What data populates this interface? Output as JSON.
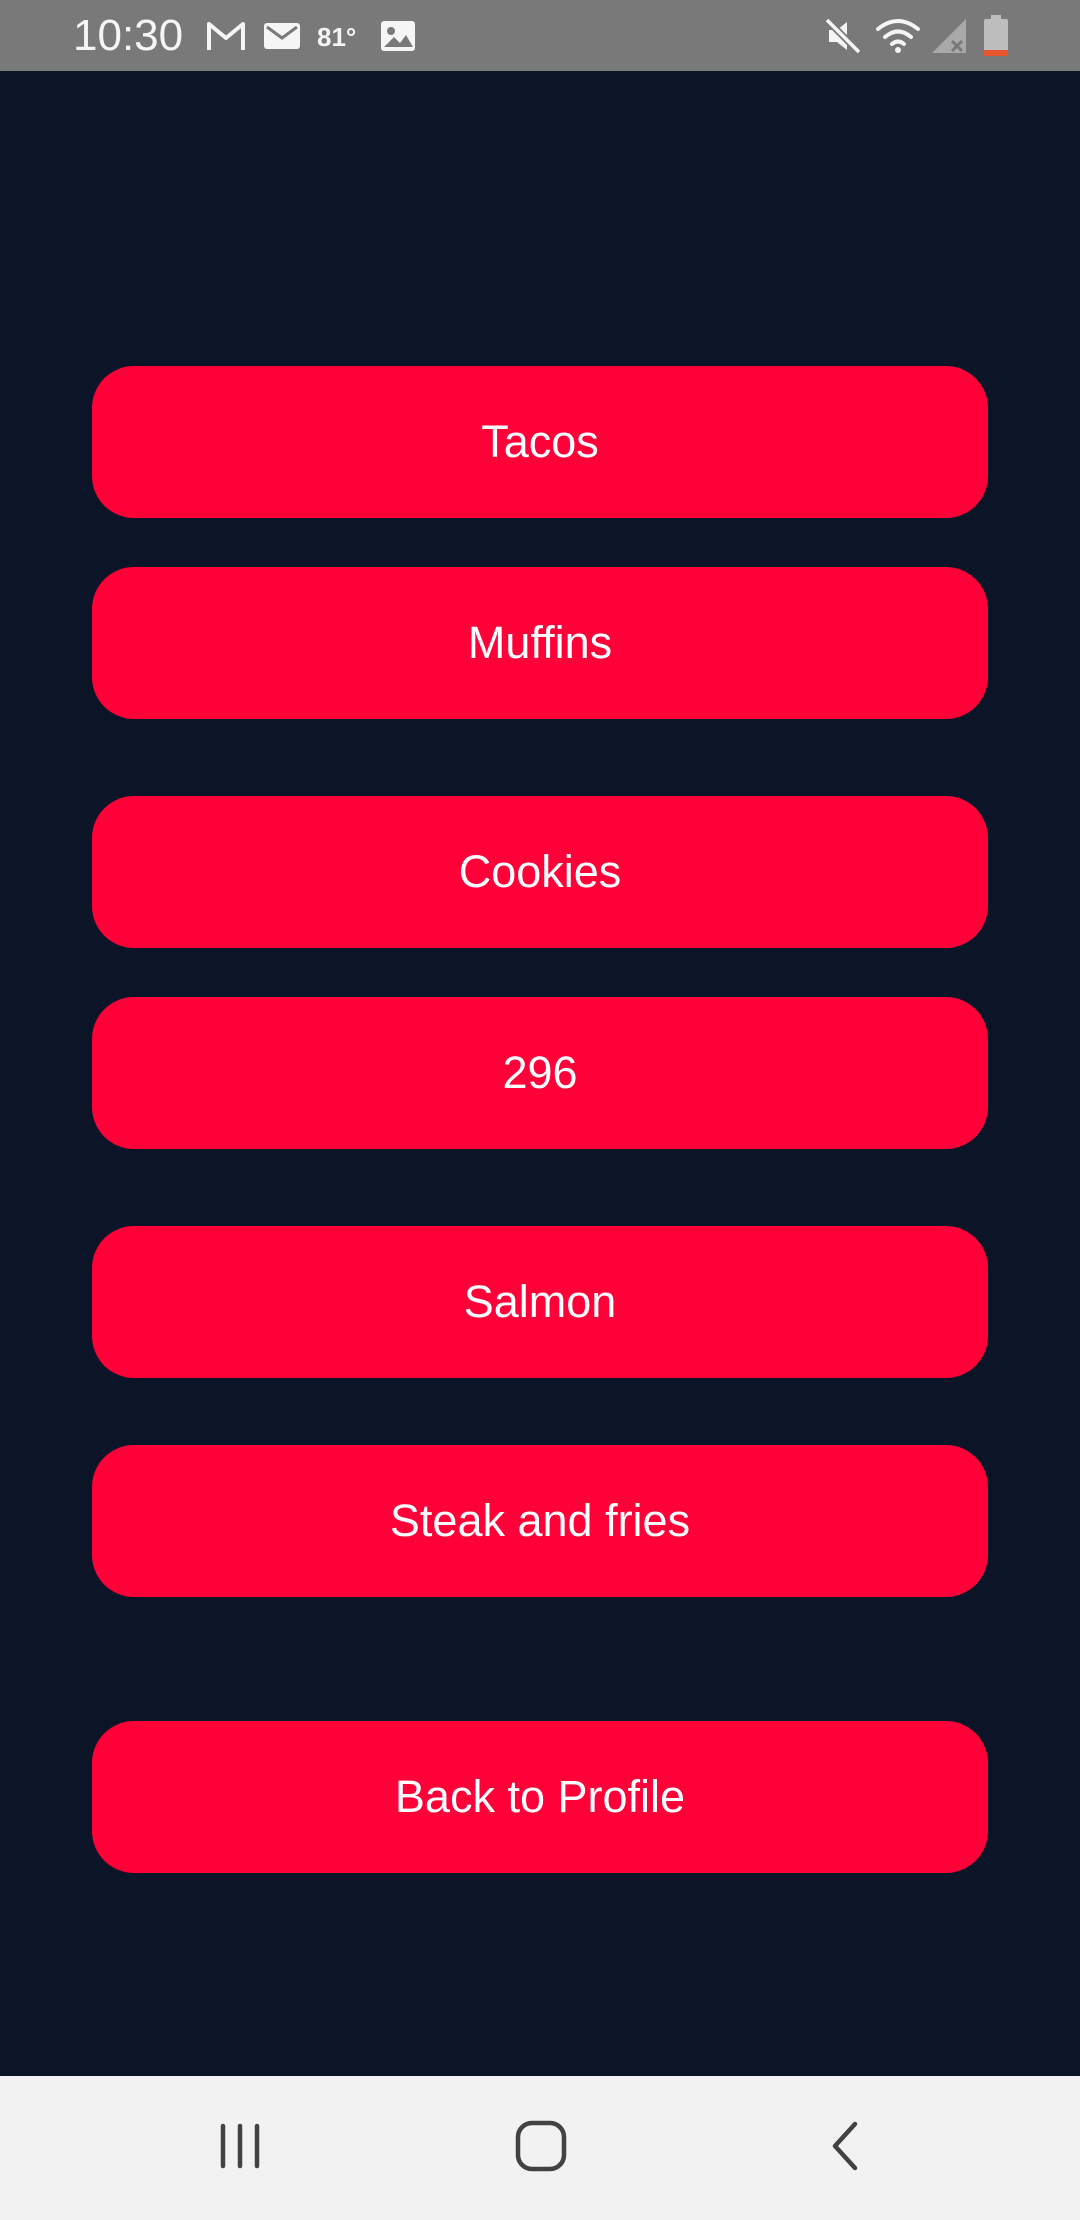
{
  "status_bar": {
    "time": "10:30",
    "temperature": "81°",
    "icons": [
      "gmail-icon",
      "email-icon",
      "image-icon",
      "mute-icon",
      "wifi-icon",
      "cellular-signal-icon",
      "battery-icon"
    ]
  },
  "colors": {
    "background": "#0b1527",
    "button": "#ff0038",
    "button_text": "#ffffff",
    "status_bar": "#797979",
    "nav_bar": "#f2f2f2",
    "battery_low": "#e8542c"
  },
  "menu": {
    "items": [
      {
        "label": "Tacos"
      },
      {
        "label": "Muffins"
      },
      {
        "label": "Cookies"
      },
      {
        "label": "296"
      },
      {
        "label": "Salmon"
      },
      {
        "label": "Steak and fries"
      }
    ],
    "back_label": "Back to Profile"
  },
  "nav_bar": {
    "icons": [
      "recent-apps-icon",
      "home-icon",
      "back-icon"
    ]
  }
}
